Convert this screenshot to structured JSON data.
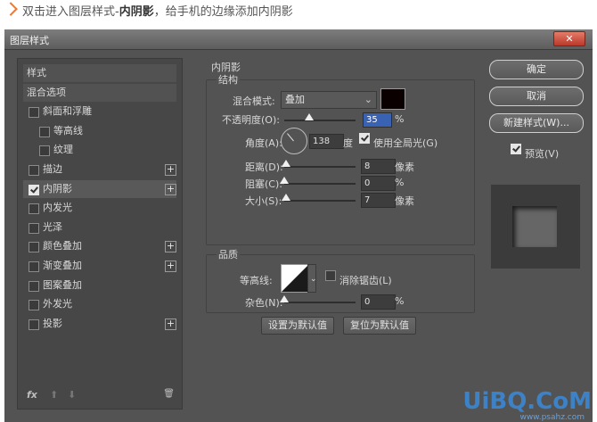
{
  "caption": {
    "text_prefix": "双击进入图层样式-",
    "highlight": "内阴影",
    "text_suffix": "，给手机的边缘添加内阴影"
  },
  "window": {
    "title": "图层样式",
    "close": "✕"
  },
  "left_panel": {
    "items": [
      {
        "label": "样式",
        "checkbox": false,
        "checked": false,
        "plus": false,
        "type": "header",
        "indent": 0
      },
      {
        "label": "混合选项",
        "checkbox": false,
        "checked": false,
        "plus": false,
        "type": "header",
        "indent": 0
      },
      {
        "label": "斜面和浮雕",
        "checkbox": true,
        "checked": false,
        "plus": false,
        "indent": 0
      },
      {
        "label": "等高线",
        "checkbox": true,
        "checked": false,
        "plus": false,
        "indent": 1
      },
      {
        "label": "纹理",
        "checkbox": true,
        "checked": false,
        "plus": false,
        "indent": 1
      },
      {
        "label": "描边",
        "checkbox": true,
        "checked": false,
        "plus": true,
        "indent": 0
      },
      {
        "label": "内阴影",
        "checkbox": true,
        "checked": true,
        "plus": true,
        "indent": 0,
        "selected": true
      },
      {
        "label": "内发光",
        "checkbox": true,
        "checked": false,
        "plus": false,
        "indent": 0
      },
      {
        "label": "光泽",
        "checkbox": true,
        "checked": false,
        "plus": false,
        "indent": 0
      },
      {
        "label": "颜色叠加",
        "checkbox": true,
        "checked": false,
        "plus": true,
        "indent": 0
      },
      {
        "label": "渐变叠加",
        "checkbox": true,
        "checked": false,
        "plus": true,
        "indent": 0
      },
      {
        "label": "图案叠加",
        "checkbox": true,
        "checked": false,
        "plus": false,
        "indent": 0
      },
      {
        "label": "外发光",
        "checkbox": true,
        "checked": false,
        "plus": false,
        "indent": 0
      },
      {
        "label": "投影",
        "checkbox": true,
        "checked": false,
        "plus": true,
        "indent": 0
      }
    ],
    "footer": {
      "fx": "fx",
      "up": "⬆",
      "down": "⬇",
      "trash": "🗑"
    }
  },
  "inner_shadow": {
    "section_title": "内阴影",
    "structure_title": "结构",
    "blend_mode_label": "混合模式:",
    "blend_mode_value": "叠加",
    "shadow_color": "#0b0000",
    "opacity_label": "不透明度(O):",
    "opacity_value": "35",
    "opacity_unit": "%",
    "opacity_level": 0.35,
    "angle_label": "角度(A):",
    "angle_value": "138",
    "angle_unit": "度",
    "global_light_label": "使用全局光(G)",
    "global_light_checked": true,
    "distance_label": "距离(D):",
    "distance_value": "8",
    "distance_unit": "像素",
    "distance_level": 0.03,
    "choke_label": "阻塞(C):",
    "choke_value": "0",
    "choke_unit": "%",
    "choke_level": 0,
    "size_label": "大小(S):",
    "size_value": "7",
    "size_unit": "像素",
    "size_level": 0.03,
    "quality_title": "品质",
    "contour_label": "等高线:",
    "antialias_label": "消除锯齿(L)",
    "antialias_checked": false,
    "noise_label": "杂色(N):",
    "noise_value": "0",
    "noise_unit": "%",
    "noise_level": 0,
    "set_default_button": "设置为默认值",
    "reset_default_button": "复位为默认值"
  },
  "right_panel": {
    "ok_button": "确定",
    "cancel_button": "取消",
    "new_style_button": "新建样式(W)...",
    "preview_label": "预览(V)",
    "preview_checked": true
  },
  "watermark": {
    "text": "UiBQ.CoM",
    "sub": "www.psahz.com"
  }
}
